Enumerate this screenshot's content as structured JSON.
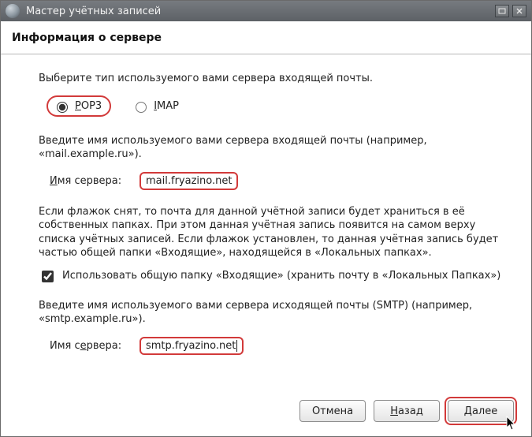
{
  "window": {
    "title": "Мастер учётных записей"
  },
  "header": {
    "heading": "Информация о сервере"
  },
  "intro": "Выберите тип используемого вами сервера входящей почты.",
  "radios": {
    "pop3_prefix": "P",
    "pop3_rest": "OP3",
    "imap_prefix": "I",
    "imap_rest": "MAP",
    "selected": "pop3"
  },
  "incoming": {
    "prompt": "Введите имя используемого вами сервера входящей почты (например, «mail.example.ru»).",
    "label_prefix": "И",
    "label_rest": "мя сервера:",
    "value": "mail.fryazino.net"
  },
  "inbox_note": "Если флажок снят, то почта для данной учётной записи будет храниться в её собственных папках. При этом данная учётная запись появится на самом верху списка учётных записей. Если флажок установлен, то данная учётная запись будет частью общей папки «Входящие», находящейся в «Локальных папках».",
  "checkbox": {
    "checked": true,
    "label": "Использовать общую папку «Входящие» (хранить почту в «Локальных Папках»)"
  },
  "outgoing": {
    "prompt": "Введите имя используемого вами сервера исходящей почты (SMTP) (например, «smtp.example.ru»).",
    "label_prefix": "Имя с",
    "label_underline": "е",
    "label_rest": "рвера:",
    "value": "smtp.fryazino.net"
  },
  "buttons": {
    "cancel": "Отмена",
    "back_prefix": "Н",
    "back_rest": "азад",
    "next_prefix": "Д",
    "next_rest": "алее"
  }
}
